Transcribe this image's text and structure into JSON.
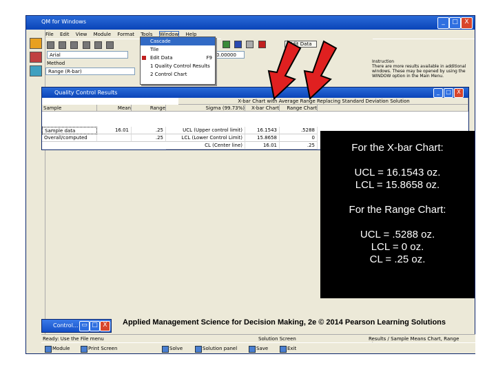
{
  "window": {
    "title": "QM for Windows",
    "controls": [
      "_",
      "□",
      "X"
    ]
  },
  "menu": [
    "File",
    "Edit",
    "View",
    "Module",
    "Format",
    "Tools",
    "Window",
    "Help"
  ],
  "window_menu": {
    "items": [
      "Cascade",
      "Tile",
      "Edit Data",
      "1 Quality Control Results",
      "2 Control Chart"
    ],
    "shortcut": "F9",
    "selected_index": 0
  },
  "toolbar": {
    "font": "Arial",
    "zoom": "0.00000",
    "edit_data_label": "Edit Data"
  },
  "method": {
    "label": "Method",
    "value": "Range (R-bar)"
  },
  "instruction": {
    "label": "Instruction",
    "text": "There are more results available in additional windows. These may be opened by using the WINDOW option in the Main Menu."
  },
  "qc_results": {
    "title": "Quality Control Results",
    "banner": "X-bar Chart with Average Range Replacing Standard Deviation Solution",
    "headers": [
      "Sample",
      "Mean",
      "Range",
      "Sigma (99.73%)",
      "X-bar Chart",
      "Range Chart"
    ],
    "rows": [
      [
        "Sample data",
        "16.01",
        ".25",
        "UCL (Upper control limit)",
        "16.1543",
        ".5288"
      ],
      [
        "Overall/computed",
        "",
        ".25",
        "LCL (Lower Control Limit)",
        "15.8658",
        "0"
      ],
      [
        "",
        "",
        "",
        "CL (Center line)",
        "16.01",
        ".25"
      ]
    ]
  },
  "overlay": {
    "xbar_heading": "For the X-bar Chart:",
    "ucl_x": "UCL = 16.1543 oz.",
    "lcl_x": "LCL = 15.8658 oz.",
    "range_heading": "For the Range Chart:",
    "ucl_r": "UCL = .5288 oz.",
    "lcl_r": "LCL = 0 oz.",
    "cl_r": "CL = .25 oz."
  },
  "footer": "Applied Management Science for Decision Making, 2e © 2014 Pearson Learning Solutions",
  "control_window": {
    "title": "Control..."
  },
  "status": [
    "Ready: Use the File menu",
    "Solution Screen",
    "Results / Sample Means Chart, Range Charts"
  ],
  "taskbar": [
    "Module",
    "Print Screen",
    "Solve",
    "Solution panel",
    "Save",
    "Exit"
  ],
  "colors": {
    "arrow": "#e02020",
    "titlebar": "#0a44b8",
    "overlay_bg": "#000000"
  }
}
